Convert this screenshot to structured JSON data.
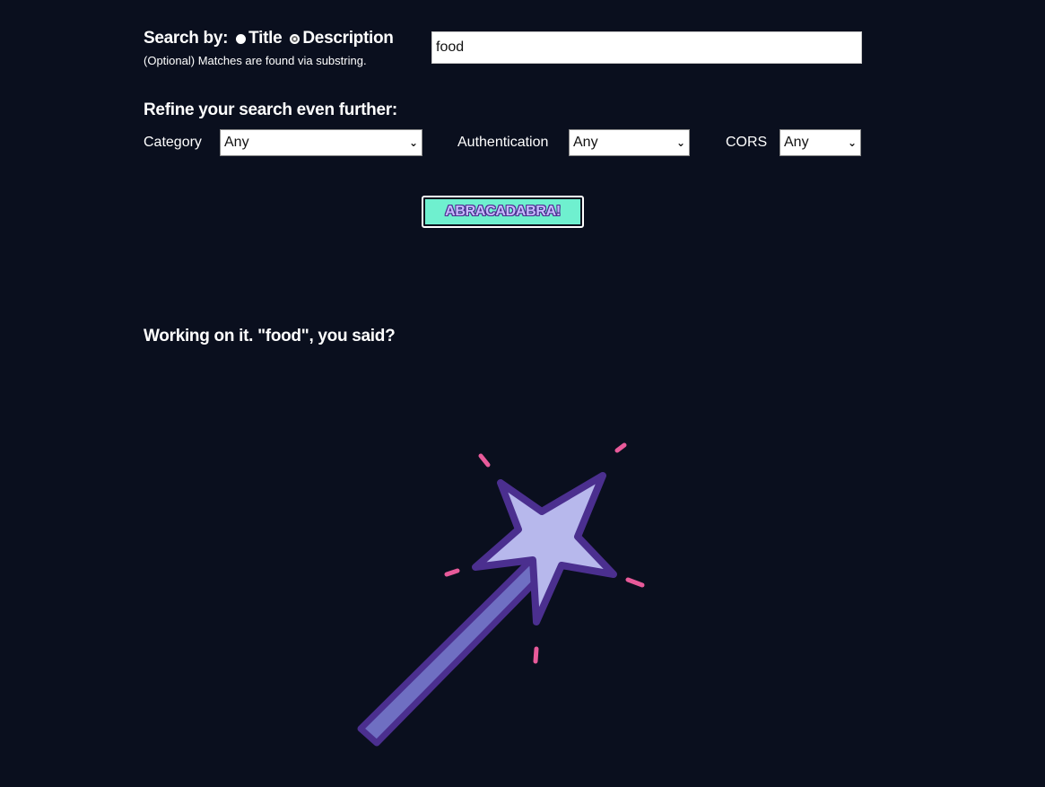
{
  "search": {
    "label": "Search by:",
    "options": [
      "Title",
      "Description"
    ],
    "selected": "Description",
    "hint": "(Optional) Matches are found via substring.",
    "value": "food"
  },
  "refine": {
    "heading": "Refine your search even further:",
    "category_label": "Category",
    "category_value": "Any",
    "auth_label": "Authentication",
    "auth_value": "Any",
    "cors_label": "CORS",
    "cors_value": "Any"
  },
  "button": {
    "label": "ABRACADABRA!"
  },
  "status": {
    "message": "Working on it. \"food\", you said?"
  },
  "colors": {
    "background": "#0a0f1e",
    "button_bg": "#6ff0cf",
    "button_text": "#c7b9ff",
    "wand_outline": "#4b2f8f",
    "wand_fill": "#b7b8ec",
    "sparkle": "#e85a9a"
  },
  "icons": {
    "wand": "magic-wand-icon"
  }
}
